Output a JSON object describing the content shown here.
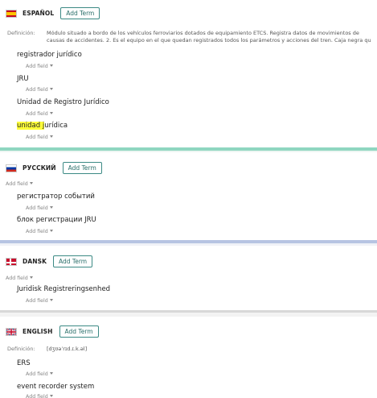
{
  "colors": {
    "accent": "#3c8a85",
    "divider_es": "#8fd6c0",
    "divider_ru": "#b7c4e2",
    "divider_da": "#d8d8d8",
    "highlight": "#ffff3a"
  },
  "common": {
    "add_term": "Add Term",
    "add_field": "Add field"
  },
  "es": {
    "flag": "spain-flag-icon",
    "name": "ESPAÑOL",
    "definition_label": "Definición:",
    "definition_line1": "Módulo situado a bordo de los vehículos ferroviarios dotados de equipamiento ETCS. Registra datos de movimientos de",
    "definition_line2": "causas de accidentes. 2. Es el equipo en el que quedan registrados todos los parámetros y acciones del tren. Caja negra qu",
    "terms": [
      "registrador jurídico",
      "JRU",
      "Unidad de Registro Jurídico"
    ],
    "term4_highlight": "unidad j",
    "term4_rest": "urídica"
  },
  "ru": {
    "flag": "russia-flag-icon",
    "name": "РУССКИЙ",
    "terms": [
      "регистратор событий",
      "блок регистрации JRU"
    ]
  },
  "da": {
    "flag": "denmark-flag-icon",
    "name": "DANSK",
    "terms": [
      "Juridisk Registreringsenhed"
    ]
  },
  "en": {
    "flag": "uk-flag-icon",
    "name": "ENGLISH",
    "definition_label": "Definición:",
    "definition_text": "[dʒʊəˈrɪd.ɪ.k.əl]",
    "terms": [
      "ERS",
      "event recorder system"
    ]
  }
}
